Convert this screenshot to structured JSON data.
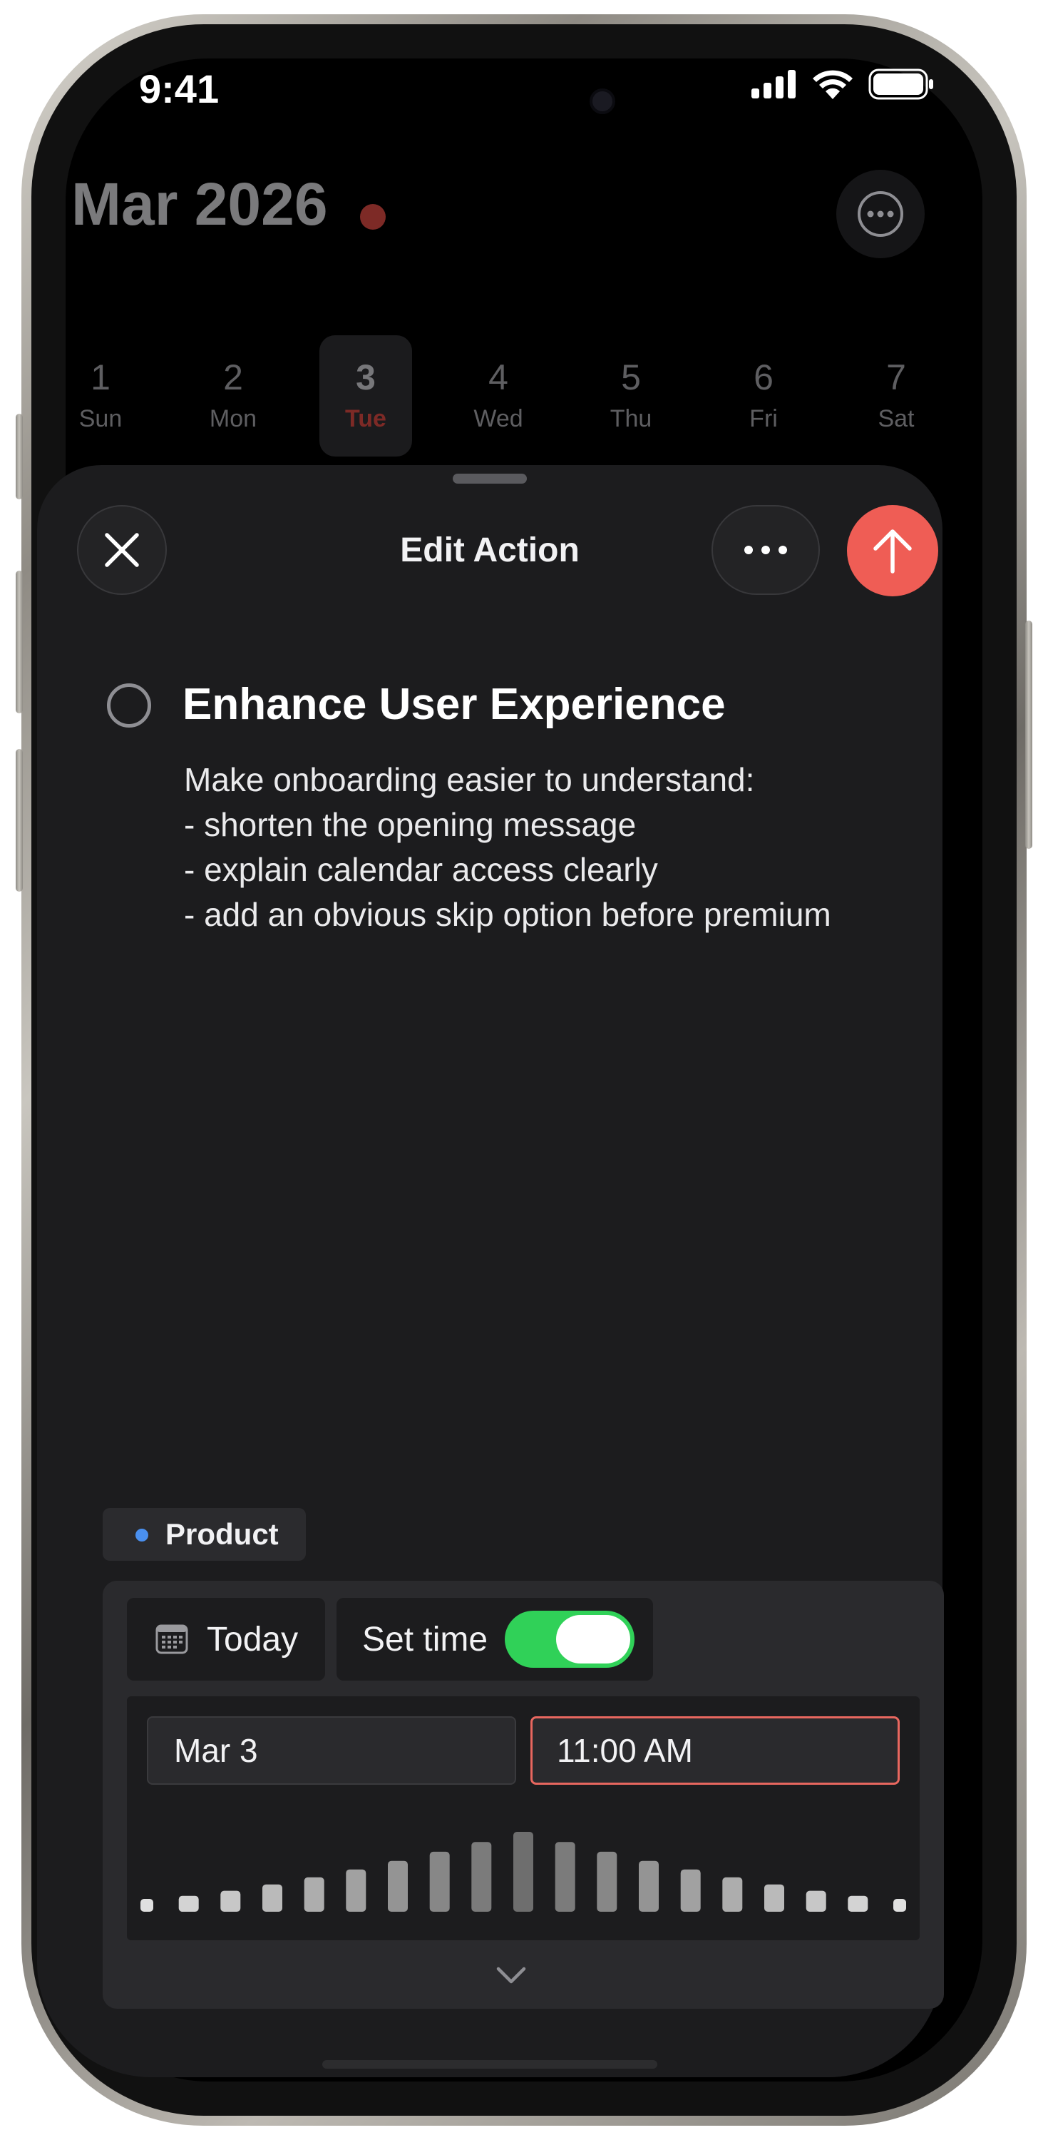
{
  "status_bar": {
    "time": "9:41"
  },
  "header": {
    "month_title": "Mar 2026"
  },
  "colors": {
    "accent_red": "#ef5d55",
    "today_dot": "#7d2a26",
    "toggle_on": "#30d158",
    "tag_dot": "#4a90f0"
  },
  "week": [
    {
      "num": "1",
      "dow": "Sun"
    },
    {
      "num": "2",
      "dow": "Mon"
    },
    {
      "num": "3",
      "dow": "Tue",
      "selected": true
    },
    {
      "num": "4",
      "dow": "Wed"
    },
    {
      "num": "5",
      "dow": "Thu"
    },
    {
      "num": "6",
      "dow": "Fri"
    },
    {
      "num": "7",
      "dow": "Sat"
    }
  ],
  "sheet": {
    "title": "Edit Action",
    "close_icon": "close-icon",
    "more_icon": "ellipsis-icon",
    "submit_icon": "arrow-up-icon"
  },
  "task": {
    "title": "Enhance User Experience",
    "notes": [
      "Make onboarding easier to understand:",
      "- shorten the opening message",
      "- explain calendar access clearly",
      "- add an obvious skip option before premium"
    ]
  },
  "tag": {
    "label": "Product"
  },
  "schedule": {
    "day_chip": "Today",
    "set_time_label": "Set time",
    "set_time_enabled": true,
    "date_value": "Mar 3",
    "time_value": "11:00 AM"
  }
}
